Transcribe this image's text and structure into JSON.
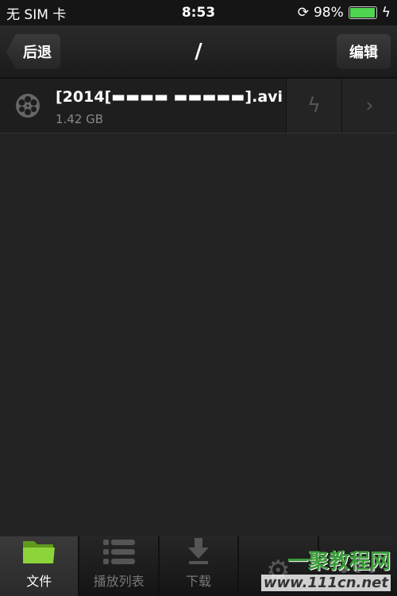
{
  "status": {
    "carrier": "无 SIM 卡",
    "time": "8:53",
    "battery": "98%",
    "battery_level": 0.98,
    "battery_color": "#4fd44f"
  },
  "nav": {
    "back": "后退",
    "title": "/",
    "edit": "编辑"
  },
  "files": [
    {
      "name": "[2014[▬▬▬▬    ▬▬▬▬▬].avi",
      "size": "1.42 GB",
      "icon": "film-reel-icon"
    }
  ],
  "tabs": [
    {
      "label": "文件",
      "icon": "folder-icon",
      "active": true
    },
    {
      "label": "播放列表",
      "icon": "list-icon"
    },
    {
      "label": "下载",
      "icon": "download-icon"
    },
    {
      "label": "",
      "icon": "gear-icon"
    },
    {
      "label": "",
      "icon": "more-icon"
    }
  ],
  "watermark": {
    "text": "一聚教程网",
    "url": "www.111cn.net"
  }
}
